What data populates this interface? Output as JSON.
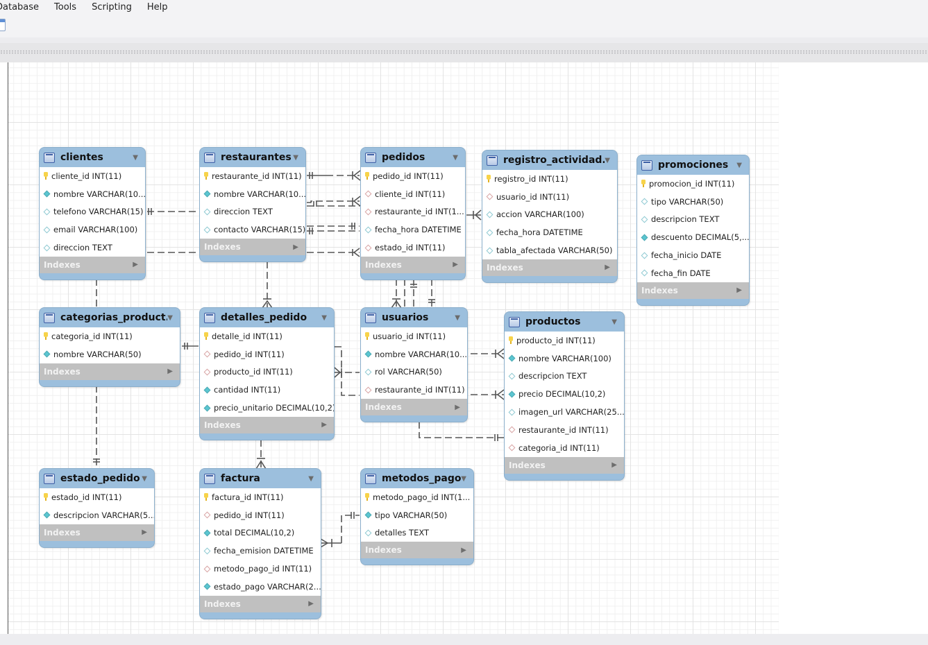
{
  "menubar": {
    "items": [
      "Database",
      "Tools",
      "Scripting",
      "Help"
    ]
  },
  "indexes_label": "Indexes",
  "tables": {
    "clientes": {
      "title": "clientes",
      "columns": [
        {
          "text": "cliente_id INT(11)",
          "icon": "pk"
        },
        {
          "text": "nombre VARCHAR(10...",
          "icon": "nn"
        },
        {
          "text": "telefono VARCHAR(15)",
          "icon": "opt"
        },
        {
          "text": "email VARCHAR(100)",
          "icon": "opt"
        },
        {
          "text": "direccion TEXT",
          "icon": "opt"
        }
      ]
    },
    "restaurantes": {
      "title": "restaurantes",
      "columns": [
        {
          "text": "restaurante_id INT(11)",
          "icon": "pk"
        },
        {
          "text": "nombre VARCHAR(10...",
          "icon": "nn"
        },
        {
          "text": "direccion TEXT",
          "icon": "opt"
        },
        {
          "text": "contacto VARCHAR(15)",
          "icon": "opt"
        }
      ]
    },
    "pedidos": {
      "title": "pedidos",
      "columns": [
        {
          "text": "pedido_id INT(11)",
          "icon": "pk"
        },
        {
          "text": "cliente_id INT(11)",
          "icon": "fk"
        },
        {
          "text": "restaurante_id INT(1...",
          "icon": "fk"
        },
        {
          "text": "fecha_hora DATETIME",
          "icon": "opt"
        },
        {
          "text": "estado_id INT(11)",
          "icon": "fk"
        }
      ]
    },
    "registro_actividad": {
      "title": "registro_actividad...",
      "columns": [
        {
          "text": "registro_id INT(11)",
          "icon": "pk"
        },
        {
          "text": "usuario_id INT(11)",
          "icon": "fk"
        },
        {
          "text": "accion VARCHAR(100)",
          "icon": "opt"
        },
        {
          "text": "fecha_hora DATETIME",
          "icon": "opt"
        },
        {
          "text": "tabla_afectada VARCHAR(50)",
          "icon": "opt"
        }
      ]
    },
    "promociones": {
      "title": "promociones",
      "columns": [
        {
          "text": "promocion_id INT(11)",
          "icon": "pk"
        },
        {
          "text": "tipo VARCHAR(50)",
          "icon": "opt"
        },
        {
          "text": "descripcion TEXT",
          "icon": "opt"
        },
        {
          "text": "descuento DECIMAL(5,...",
          "icon": "nn"
        },
        {
          "text": "fecha_inicio DATE",
          "icon": "opt"
        },
        {
          "text": "fecha_fin DATE",
          "icon": "opt"
        }
      ]
    },
    "categorias_productos": {
      "title": "categorias_product...",
      "columns": [
        {
          "text": "categoria_id INT(11)",
          "icon": "pk"
        },
        {
          "text": "nombre VARCHAR(50)",
          "icon": "nn"
        }
      ]
    },
    "detalles_pedido": {
      "title": "detalles_pedido",
      "columns": [
        {
          "text": "detalle_id INT(11)",
          "icon": "pk"
        },
        {
          "text": "pedido_id INT(11)",
          "icon": "fk"
        },
        {
          "text": "producto_id INT(11)",
          "icon": "fk"
        },
        {
          "text": "cantidad INT(11)",
          "icon": "nn"
        },
        {
          "text": "precio_unitario DECIMAL(10,2)",
          "icon": "nn"
        }
      ]
    },
    "usuarios": {
      "title": "usuarios",
      "columns": [
        {
          "text": "usuario_id INT(11)",
          "icon": "pk"
        },
        {
          "text": "nombre VARCHAR(10...",
          "icon": "nn"
        },
        {
          "text": "rol VARCHAR(50)",
          "icon": "opt"
        },
        {
          "text": "restaurante_id INT(11)",
          "icon": "fk"
        }
      ]
    },
    "productos": {
      "title": "productos",
      "columns": [
        {
          "text": "producto_id INT(11)",
          "icon": "pk"
        },
        {
          "text": "nombre VARCHAR(100)",
          "icon": "nn"
        },
        {
          "text": "descripcion TEXT",
          "icon": "opt"
        },
        {
          "text": "precio DECIMAL(10,2)",
          "icon": "nn"
        },
        {
          "text": "imagen_url VARCHAR(25...",
          "icon": "opt"
        },
        {
          "text": "restaurante_id INT(11)",
          "icon": "fk"
        },
        {
          "text": "categoria_id INT(11)",
          "icon": "fk"
        }
      ]
    },
    "estado_pedido": {
      "title": "estado_pedido",
      "columns": [
        {
          "text": "estado_id INT(11)",
          "icon": "pk"
        },
        {
          "text": "descripcion VARCHAR(5...",
          "icon": "nn"
        }
      ]
    },
    "factura": {
      "title": "factura",
      "columns": [
        {
          "text": "factura_id INT(11)",
          "icon": "pk"
        },
        {
          "text": "pedido_id INT(11)",
          "icon": "fk"
        },
        {
          "text": "total DECIMAL(10,2)",
          "icon": "nn"
        },
        {
          "text": "fecha_emision DATETIME",
          "icon": "opt"
        },
        {
          "text": "metodo_pago_id INT(11)",
          "icon": "fk"
        },
        {
          "text": "estado_pago VARCHAR(2...",
          "icon": "nn"
        }
      ]
    },
    "metodos_pago": {
      "title": "metodos_pago",
      "columns": [
        {
          "text": "metodo_pago_id INT(1...",
          "icon": "pk"
        },
        {
          "text": "tipo VARCHAR(50)",
          "icon": "nn"
        },
        {
          "text": "detalles TEXT",
          "icon": "opt"
        }
      ]
    }
  },
  "relationships": [
    {
      "from": "clientes",
      "to": "pedidos",
      "cardinality": "one-to-many"
    },
    {
      "from": "restaurantes",
      "to": "pedidos",
      "cardinality": "one-to-many"
    },
    {
      "from": "restaurantes",
      "to": "usuarios",
      "cardinality": "one-to-many"
    },
    {
      "from": "restaurantes",
      "to": "productos",
      "cardinality": "one-to-many"
    },
    {
      "from": "estado_pedido",
      "to": "pedidos",
      "cardinality": "one-to-many"
    },
    {
      "from": "pedidos",
      "to": "detalles_pedido",
      "cardinality": "one-to-many"
    },
    {
      "from": "pedidos",
      "to": "factura",
      "cardinality": "one-to-many"
    },
    {
      "from": "usuarios",
      "to": "registro_actividad",
      "cardinality": "one-to-many"
    },
    {
      "from": "productos",
      "to": "detalles_pedido",
      "cardinality": "one-to-many"
    },
    {
      "from": "categorias_productos",
      "to": "productos",
      "cardinality": "one-to-many"
    },
    {
      "from": "metodos_pago",
      "to": "factura",
      "cardinality": "one-to-many"
    }
  ]
}
